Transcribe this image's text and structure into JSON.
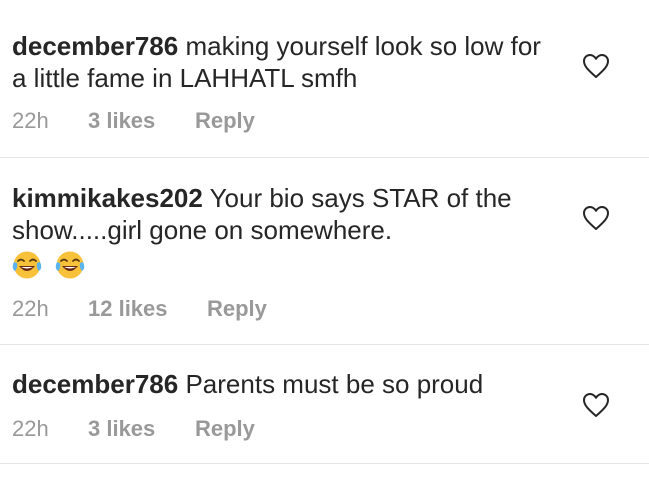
{
  "comments": [
    {
      "username": "december786",
      "text": "making yourself look so low for a little fame in LAHHATL smfh",
      "time": "22h",
      "likes": "3 likes",
      "reply": "Reply",
      "heart_icon": "heart-outline-icon"
    },
    {
      "username": "kimmikakes202",
      "text": "Your bio says STAR of the show.....girl gone on somewhere.",
      "emojis": [
        "face-with-tears-of-joy",
        "face-with-tears-of-joy"
      ],
      "time": "22h",
      "likes": "12 likes",
      "reply": "Reply",
      "heart_icon": "heart-outline-icon"
    },
    {
      "username": "december786",
      "text": "Parents must be so proud",
      "time": "22h",
      "likes": "3 likes",
      "reply": "Reply",
      "heart_icon": "heart-outline-icon"
    }
  ],
  "colors": {
    "text": "#262626",
    "meta": "#999999",
    "divider": "#e6e6e6",
    "emoji_face": "#f7c13a"
  }
}
